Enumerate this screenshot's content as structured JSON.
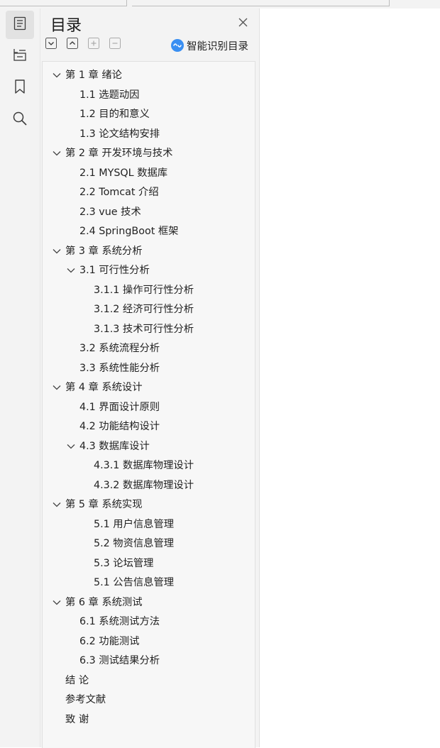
{
  "panel": {
    "title": "目录",
    "smart_button_label": "智能识别目录"
  },
  "icons": {
    "rail": [
      "outline-icon",
      "table-of-figures-icon",
      "bookmark-icon",
      "search-icon"
    ],
    "toolbar": [
      "collapse-all-icon",
      "expand-all-icon",
      "add-heading-icon",
      "remove-heading-icon"
    ]
  },
  "outline": [
    {
      "level": 1,
      "expanded": true,
      "text": "第 1 章  绪论"
    },
    {
      "level": 2,
      "expanded": null,
      "text": "1.1 选题动因"
    },
    {
      "level": 2,
      "expanded": null,
      "text": "1.2 目的和意义"
    },
    {
      "level": 2,
      "expanded": null,
      "text": "1.3 论文结构安排"
    },
    {
      "level": 1,
      "expanded": true,
      "text": "第 2 章  开发环境与技术"
    },
    {
      "level": 2,
      "expanded": null,
      "text": "2.1 MYSQL 数据库"
    },
    {
      "level": 2,
      "expanded": null,
      "text": "2.2 Tomcat  介绍"
    },
    {
      "level": 2,
      "expanded": null,
      "text": "2.3 vue 技术"
    },
    {
      "level": 2,
      "expanded": null,
      "text": "2.4 SpringBoot 框架"
    },
    {
      "level": 1,
      "expanded": true,
      "text": "第 3 章  系统分析"
    },
    {
      "level": 2,
      "expanded": true,
      "text": "3.1 可行性分析"
    },
    {
      "level": 3,
      "expanded": null,
      "text": "3.1.1 操作可行性分析"
    },
    {
      "level": 3,
      "expanded": null,
      "text": "3.1.2 经济可行性分析"
    },
    {
      "level": 3,
      "expanded": null,
      "text": "3.1.3 技术可行性分析"
    },
    {
      "level": 2,
      "expanded": null,
      "text": "3.2 系统流程分析"
    },
    {
      "level": 2,
      "expanded": null,
      "text": "3.3 系统性能分析"
    },
    {
      "level": 1,
      "expanded": true,
      "text": "第 4 章  系统设计"
    },
    {
      "level": 2,
      "expanded": null,
      "text": "4.1 界面设计原则"
    },
    {
      "level": 2,
      "expanded": null,
      "text": "4.2 功能结构设计"
    },
    {
      "level": 2,
      "expanded": true,
      "text": "4.3 数据库设计"
    },
    {
      "level": 3,
      "expanded": null,
      "text": "4.3.1  数据库物理设计"
    },
    {
      "level": 3,
      "expanded": null,
      "text": "4.3.2  数据库物理设计"
    },
    {
      "level": 1,
      "expanded": true,
      "text": "第 5 章  系统实现"
    },
    {
      "level": 3,
      "expanded": null,
      "text": "5.1 用户信息管理"
    },
    {
      "level": 3,
      "expanded": null,
      "text": "5.2 物资信息管理"
    },
    {
      "level": 3,
      "expanded": null,
      "text": "5.3 论坛管理"
    },
    {
      "level": 3,
      "expanded": null,
      "text": "5.1 公告信息管理"
    },
    {
      "level": 1,
      "expanded": true,
      "text": "第 6 章  系统测试"
    },
    {
      "level": 2,
      "expanded": null,
      "text": "6.1  系统测试方法"
    },
    {
      "level": 2,
      "expanded": null,
      "text": "6.2  功能测试"
    },
    {
      "level": 2,
      "expanded": null,
      "text": "6.3  测试结果分析"
    },
    {
      "level": 1,
      "expanded": null,
      "text": "结    论"
    },
    {
      "level": 1,
      "expanded": null,
      "text": "参考文献"
    },
    {
      "level": 1,
      "expanded": null,
      "text": "致    谢"
    }
  ]
}
